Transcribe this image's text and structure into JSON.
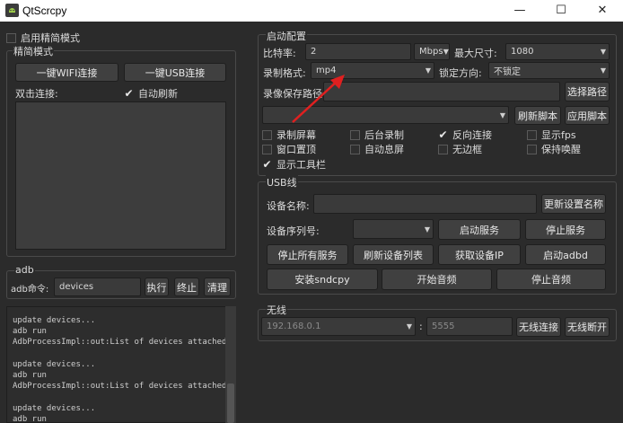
{
  "window": {
    "title": "QtScrcpy",
    "minimize": "—",
    "maximize": "☐",
    "close": "✕"
  },
  "simple_mode": {
    "checkbox_label": "启用精简模式",
    "checked": false
  },
  "left": {
    "group_title": "精简模式",
    "wifi_button": "一键WIFI连接",
    "usb_button": "一键USB连接",
    "double_click_label": "双击连接:",
    "auto_refresh_label": "自动刷新",
    "auto_refresh_checked": true
  },
  "adb": {
    "group_title": "adb",
    "command_label": "adb命令:",
    "command_value": "devices",
    "execute_button": "执行",
    "stop_button": "终止",
    "clear_button": "清理",
    "log_lines": [
      "update devices...",
      "adb run",
      "AdbProcessImpl::out:List of devices attached",
      "",
      "update devices...",
      "adb run",
      "AdbProcessImpl::out:List of devices attached",
      "",
      "update devices...",
      "adb run"
    ]
  },
  "config": {
    "group_title": "启动配置",
    "bitrate_label": "比特率:",
    "bitrate_value": "2",
    "bitrate_unit": "Mbps",
    "max_size_label": "最大尺寸:",
    "max_size_value": "1080",
    "record_format_label": "录制格式:",
    "record_format_value": "mp4",
    "lock_orientation_label": "锁定方向:",
    "lock_orientation_value": "不锁定",
    "record_path_label": "录像保存路径",
    "record_path_value": "",
    "select_path_button": "选择路径",
    "script_value": "",
    "refresh_script_button": "刷新脚本",
    "apply_script_button": "应用脚本",
    "options": [
      {
        "label": "录制屏幕",
        "checked": false
      },
      {
        "label": "后台录制",
        "checked": false
      },
      {
        "label": "反向连接",
        "checked": true
      },
      {
        "label": "显示fps",
        "checked": false
      },
      {
        "label": "窗口置顶",
        "checked": false
      },
      {
        "label": "自动息屏",
        "checked": false
      },
      {
        "label": "无边框",
        "checked": false
      },
      {
        "label": "保持唤醒",
        "checked": false
      },
      {
        "label": "显示工具栏",
        "checked": true
      }
    ]
  },
  "usb": {
    "group_title": "USB线",
    "device_name_label": "设备名称:",
    "device_name_value": "",
    "update_name_button": "更新设置名称",
    "serial_label": "设备序列号:",
    "serial_value": "",
    "start_service_button": "启动服务",
    "stop_service_button": "停止服务",
    "stop_all_button": "停止所有服务",
    "refresh_devices_button": "刷新设备列表",
    "get_ip_button": "获取设备IP",
    "start_adbd_button": "启动adbd",
    "install_sndcpy_button": "安装sndcpy",
    "start_audio_button": "开始音频",
    "stop_audio_button": "停止音频"
  },
  "wireless": {
    "group_title": "无线",
    "ip_placeholder": "192.168.0.1",
    "separator": ":",
    "port_placeholder": "5555",
    "connect_button": "无线连接",
    "disconnect_button": "无线断开"
  },
  "annotation": {
    "arrow_color": "#e02020"
  }
}
